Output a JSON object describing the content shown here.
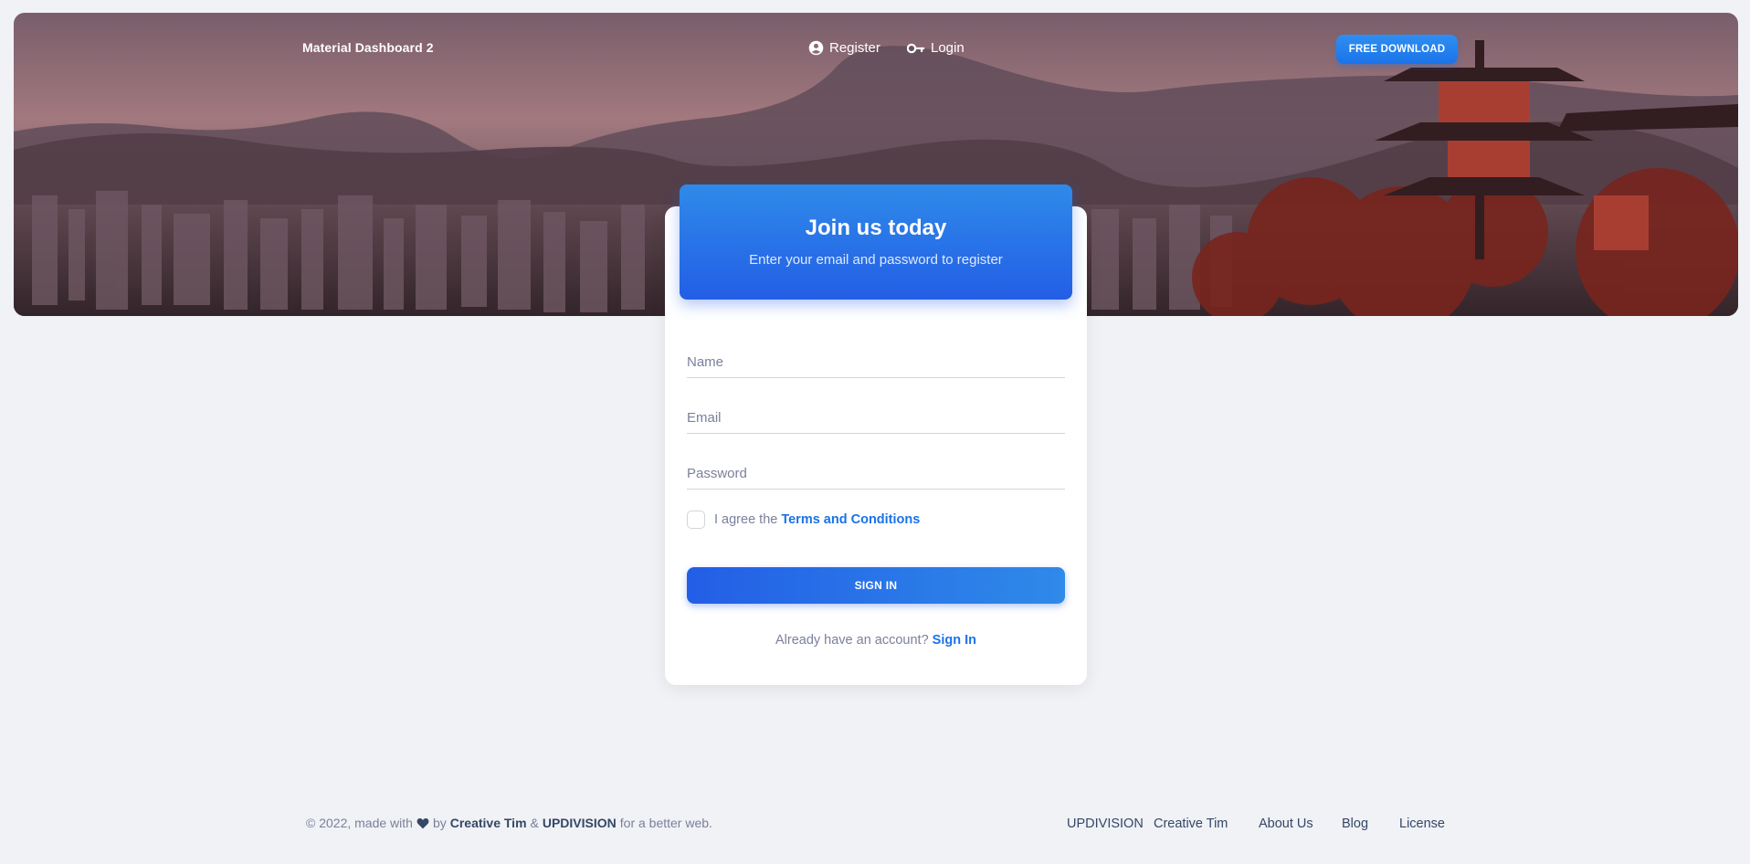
{
  "navbar": {
    "brand": "Material Dashboard 2",
    "links": [
      {
        "label": "Register",
        "icon": "account-circle-icon"
      },
      {
        "label": "Login",
        "icon": "key-icon"
      }
    ],
    "download_label": "FREE DOWNLOAD"
  },
  "card": {
    "title": "Join us today",
    "subtitle": "Enter your email and password to register",
    "fields": [
      {
        "placeholder": "Name",
        "value": ""
      },
      {
        "placeholder": "Email",
        "value": ""
      },
      {
        "placeholder": "Password",
        "value": ""
      }
    ],
    "agree_text": "I agree the",
    "terms_label": "Terms and Conditions",
    "submit_label": "SIGN IN",
    "already_text": "Already have an account?",
    "signin_link": "Sign In"
  },
  "footer": {
    "copyright": "© 2022, made with",
    "by": "by",
    "author1": "Creative Tim",
    "amp": "&",
    "author2": "UPDIVISION",
    "suffix": "for a better web.",
    "links": [
      "UPDIVISION",
      "Creative Tim",
      "About Us",
      "Blog",
      "License"
    ]
  },
  "colors": {
    "accent": "#1a73e8",
    "background": "#f0f2f5",
    "text": "#344767",
    "muted": "#7b809a"
  }
}
